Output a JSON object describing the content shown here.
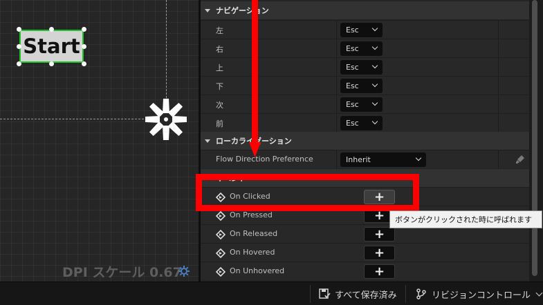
{
  "canvas": {
    "start_button_label": "Start",
    "dpi_label": "DPI スケール 0.67"
  },
  "sections": {
    "navigation": {
      "title": "ナビゲーション",
      "rows": [
        {
          "label": "左",
          "value": "Esc"
        },
        {
          "label": "右",
          "value": "Esc"
        },
        {
          "label": "上",
          "value": "Esc"
        },
        {
          "label": "下",
          "value": "Esc"
        },
        {
          "label": "次",
          "value": "Esc"
        },
        {
          "label": "前",
          "value": "Esc"
        }
      ]
    },
    "localization": {
      "title": "ローカライゼーション",
      "row": {
        "label": "Flow Direction Preference",
        "value": "Inherit"
      }
    },
    "events": {
      "title": "イベント",
      "rows": [
        {
          "label": "On Clicked"
        },
        {
          "label": "On Pressed"
        },
        {
          "label": "On Released"
        },
        {
          "label": "On Hovered"
        },
        {
          "label": "On Unhovered"
        }
      ],
      "add_symbol": "+"
    }
  },
  "tooltip": "ボタンがクリックされた時に呼ばれます",
  "bottom_bar": {
    "save_label": "すべて保存済み",
    "revision_label": "リビジョンコントロール"
  },
  "colors": {
    "accent": "#ff0000",
    "selection": "#22c22a"
  }
}
